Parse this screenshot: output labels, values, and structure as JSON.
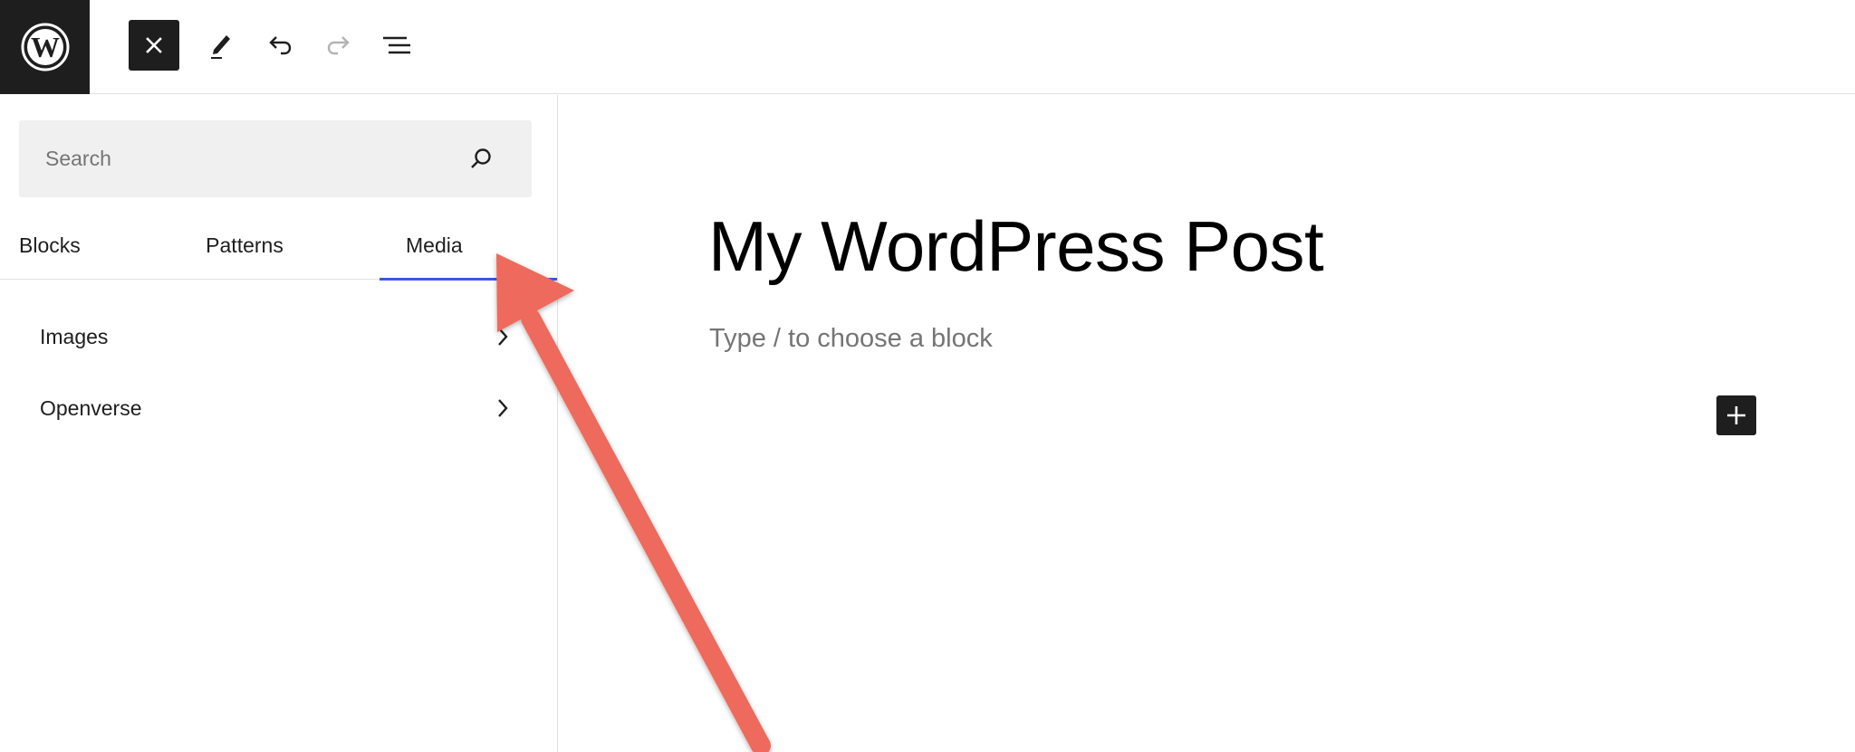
{
  "toolbar": {
    "logo": "wordpress-logo",
    "close": "close-icon",
    "tools": "pencil-icon",
    "undo": "undo-icon",
    "redo": "redo-icon",
    "list_view": "list-view-icon"
  },
  "sidebar": {
    "search": {
      "placeholder": "Search",
      "value": ""
    },
    "tabs": [
      {
        "label": "Blocks"
      },
      {
        "label": "Patterns"
      },
      {
        "label": "Media",
        "selected": true
      }
    ],
    "categories": [
      {
        "label": "Images"
      },
      {
        "label": "Openverse"
      }
    ]
  },
  "editor": {
    "title": "My WordPress Post",
    "placeholder": "Type / to choose a block"
  },
  "colors": {
    "dark": "#1e1e1e",
    "accent": "#3858e9",
    "arrow": "#ee6a5b"
  }
}
